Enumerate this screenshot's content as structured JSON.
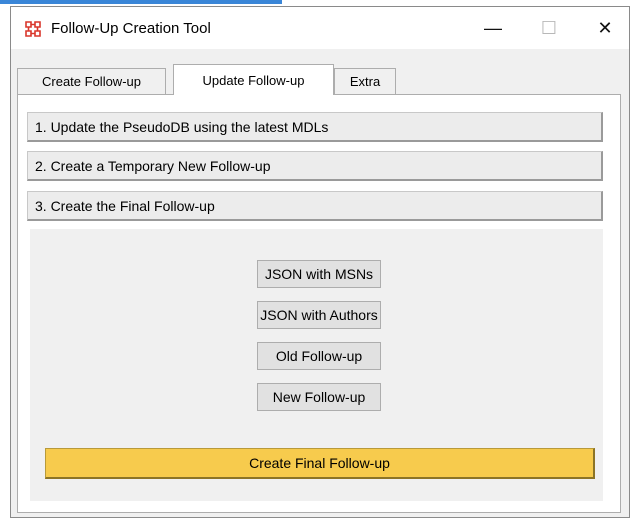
{
  "window": {
    "title": "Follow-Up Creation Tool",
    "icon": "app-grid-icon",
    "controls": {
      "minimize": "—",
      "maximize": "☐",
      "close": "✕"
    }
  },
  "tabs": [
    {
      "label": "Create Follow-up",
      "active": false
    },
    {
      "label": "Update Follow-up",
      "active": true
    },
    {
      "label": "Extra",
      "active": false
    }
  ],
  "steps": [
    {
      "label": "1. Update the PseudoDB using the latest MDLs"
    },
    {
      "label": "2. Create a Temporary New Follow-up"
    },
    {
      "label": "3. Create the Final Follow-up"
    }
  ],
  "final_step": {
    "file_buttons": [
      {
        "label": "JSON with MSNs"
      },
      {
        "label": "JSON with Authors"
      },
      {
        "label": "Old Follow-up"
      },
      {
        "label": "New Follow-up"
      }
    ],
    "create_button": {
      "label": "Create Final Follow-up"
    }
  },
  "colors": {
    "accent": "#3a86d8",
    "icon_red": "#d9362b",
    "create_button": "#f7cb4d"
  }
}
